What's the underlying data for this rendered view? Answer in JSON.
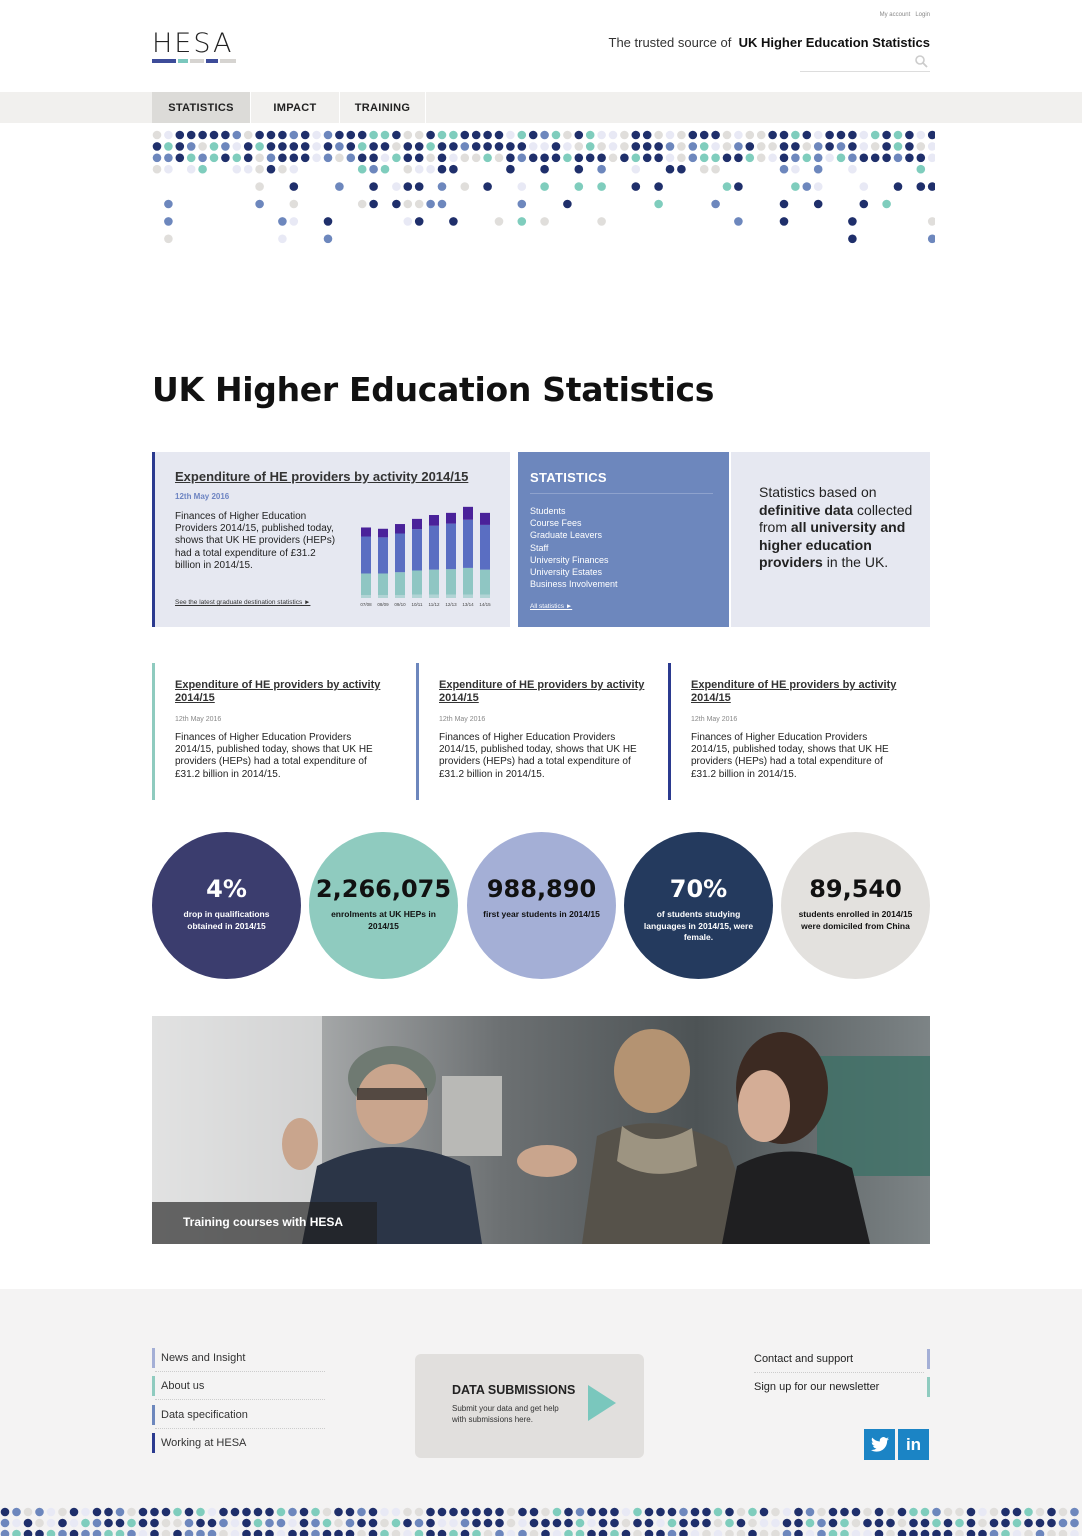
{
  "header": {
    "toplinks": [
      "My account",
      "Login"
    ],
    "logo": "HESA",
    "tagline_prefix": "The trusted source of",
    "tagline_bold": "UK Higher Education Statistics"
  },
  "nav": {
    "tabs": [
      "STATISTICS",
      "IMPACT",
      "TRAINING"
    ]
  },
  "colors": {
    "navy": "#1f2f6b",
    "mid_blue": "#6d87bd",
    "teal": "#7fcdbd",
    "light_grey": "#e0dedb",
    "pale_lilac": "#e8e9f5",
    "chart_purple": "#4a229a",
    "chart_blue": "#5a6ec2",
    "chart_teal": "#8fc6c3"
  },
  "page_title": "UK Higher Education Statistics",
  "feature": {
    "title": "Expenditure of HE providers by activity 2014/15",
    "date": "12th May 2016",
    "body": "Finances of Higher Education Providers 2014/15, published today, shows that UK HE providers (HEPs) had a total expenditure of £31.2 billion in 2014/15.",
    "link": "See the latest graduate destination statistics ►"
  },
  "chart_data": {
    "type": "bar",
    "categories": [
      "07/08",
      "08/09",
      "09/10",
      "10/11",
      "11/12",
      "12/13",
      "13/14",
      "14/15"
    ],
    "series": [
      {
        "values": [
          0.7,
          0.7,
          0.7,
          0.8,
          0.8,
          0.8,
          0.8,
          0.8
        ]
      },
      {
        "values": [
          5.0,
          5.0,
          5.3,
          5.6,
          5.8,
          5.9,
          6.2,
          5.8
        ]
      },
      {
        "values": [
          8.6,
          8.4,
          9.0,
          9.6,
          10.2,
          10.6,
          11.2,
          10.4
        ]
      },
      {
        "values": [
          2.1,
          2.0,
          2.2,
          2.4,
          2.5,
          2.5,
          3.0,
          2.8
        ]
      }
    ]
  },
  "statistics_box": {
    "heading": "STATISTICS",
    "items": [
      "Students",
      "Course Fees",
      "Graduate Leavers",
      "Staff",
      "University Finances",
      "University Estates",
      "Business Involvement"
    ],
    "all_link": "All statistics ►"
  },
  "info_box": {
    "t1": "Statistics based on",
    "b1": "definitive data",
    "t2": "collected from",
    "b2": "all university and higher education providers",
    "t3": "in the UK."
  },
  "articles": [
    {
      "title": "Expenditure of HE providers by activity 2014/15",
      "date": "12th May 2016",
      "body": "Finances of Higher Education Providers 2014/15, published today, shows that UK HE providers (HEPs) had a total expenditure of £31.2 billion in 2014/15."
    },
    {
      "title": "Expenditure of HE providers by activity 2014/15",
      "date": "12th May 2016",
      "body": "Finances of Higher Education Providers 2014/15, published today, shows that UK HE providers (HEPs) had a total expenditure of £31.2 billion in 2014/15."
    },
    {
      "title": "Expenditure of HE providers by activity 2014/15",
      "date": "12th May 2016",
      "body": "Finances of Higher Education Providers 2014/15, published today, shows that UK HE providers (HEPs) had a total expenditure of £31.2 billion in 2014/15."
    }
  ],
  "stats": [
    {
      "value": "4%",
      "label": "drop in qualifications obtained in 2014/15",
      "bg": "#3b3d6e",
      "fg": "#ffffff"
    },
    {
      "value": "2,266,075",
      "label": "enrolments at UK HEPs in 2014/15",
      "bg": "#8fcbbf",
      "fg": "#111111"
    },
    {
      "value": "988,890",
      "label": "first year students in 2014/15",
      "bg": "#a4afd6",
      "fg": "#111111"
    },
    {
      "value": "70%",
      "label": "of students studying languages in 2014/15, were female.",
      "bg": "#243a5e",
      "fg": "#ffffff"
    },
    {
      "value": "89,540",
      "label": "students enrolled in 2014/15 were domiciled from China",
      "bg": "#e3e1de",
      "fg": "#111111"
    }
  ],
  "banner": {
    "caption": "Training courses with HESA"
  },
  "footer": {
    "left_links": [
      "News and Insight",
      "About us",
      "Data specification",
      "Working at HESA"
    ],
    "data_submissions": {
      "heading": "DATA SUBMISSIONS",
      "body": "Submit your data and get help with submissions here."
    },
    "right_links": [
      "Contact and support",
      "Sign up for our newsletter"
    ],
    "social": [
      {
        "icon": "twitter-icon"
      },
      {
        "icon": "linkedin-icon",
        "text": "in"
      }
    ]
  }
}
